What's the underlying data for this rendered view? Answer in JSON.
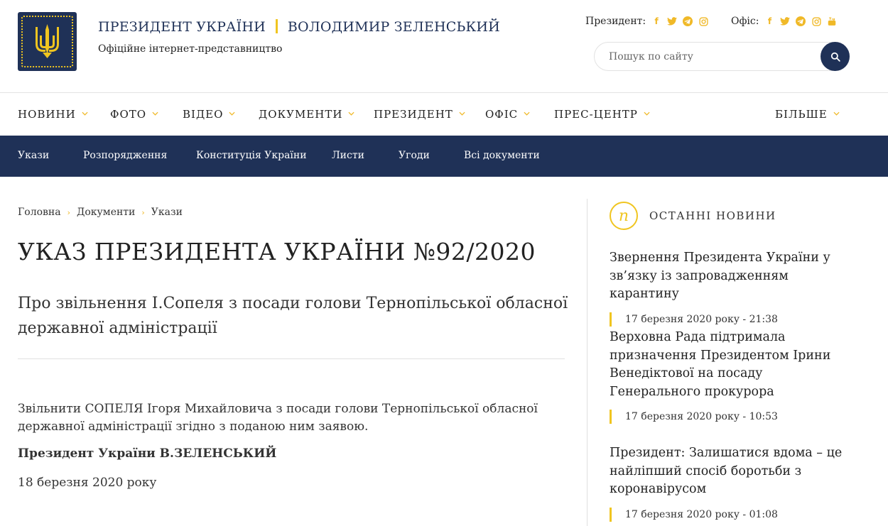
{
  "header": {
    "title_left": "ПРЕЗИДЕНТ УКРАЇНИ",
    "title_right": "ВОЛОДИМИР ЗЕЛЕНСЬКИЙ",
    "subtitle": "Офіційне інтернет-представництво",
    "social_president_label": "Президент:",
    "social_office_label": "Офіс:",
    "search_placeholder": "Пошук по сайту"
  },
  "icons": {
    "facebook": "f",
    "brand_color": "#1f3157",
    "accent_color": "#f0c520"
  },
  "main_nav": [
    {
      "label": "НОВИНИ"
    },
    {
      "label": "ФОТО"
    },
    {
      "label": "ВІДЕО"
    },
    {
      "label": "ДОКУМЕНТИ"
    },
    {
      "label": "ПРЕЗИДЕНТ"
    },
    {
      "label": "ОФІС"
    },
    {
      "label": "ПРЕС-ЦЕНТР"
    },
    {
      "label": "БІЛЬШЕ"
    }
  ],
  "sub_nav": [
    {
      "label": "Укази"
    },
    {
      "label": "Розпорядження"
    },
    {
      "label": "Конституція України"
    },
    {
      "label": "Листи"
    },
    {
      "label": "Угоди"
    },
    {
      "label": "Всі документи"
    }
  ],
  "breadcrumb": [
    "Головна",
    "Документи",
    "Укази"
  ],
  "document": {
    "title": "УКАЗ ПРЕЗИДЕНТА УКРАЇНИ №92/2020",
    "subtitle": "Про звільнення І.Сопеля з посади голови Тернопільської обласної державної адміністрації",
    "body": "Звільнити СОПЕЛЯ Ігоря Михайловича з посади голови Тернопільської обласної державної адміністрації згідно з поданою ним заявою.",
    "signature": "Президент України В.ЗЕЛЕНСЬКИЙ",
    "date": "18 березня 2020 року"
  },
  "sidebar": {
    "badge_letter": "n",
    "heading": "ОСТАННІ НОВИНИ",
    "news": [
      {
        "title": "Звернення Президента України у зв’язку із запровадженням карантину",
        "date": "17 березня 2020 року - 21:38"
      },
      {
        "title": "Верховна Рада підтримала призначення Президентом Ірини Венедіктової на посаду Генерального прокурора",
        "date": "17 березня 2020 року - 10:53"
      },
      {
        "title": "Президент: Залишатися вдома – це найліпший спосіб боротьби з коронавірусом",
        "date": "17 березня 2020 року - 01:08"
      }
    ]
  }
}
